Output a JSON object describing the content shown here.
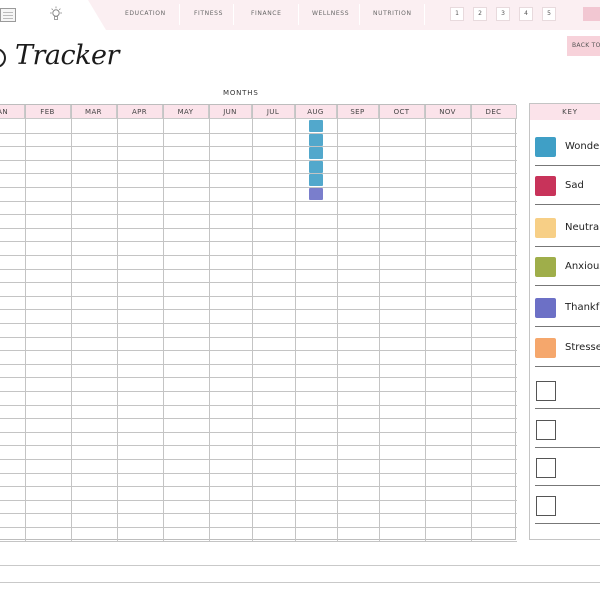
{
  "nav": {
    "icons": [
      "calendar-icon",
      "lightbulb-icon"
    ],
    "items": [
      "EDUCATION",
      "FITNESS",
      "FINANCE",
      "WELLNESS",
      "NUTRITION"
    ],
    "pages": [
      "1",
      "2",
      "3",
      "4",
      "5"
    ]
  },
  "header": {
    "title": "Tracker",
    "back_label": "BACK TO"
  },
  "grid": {
    "heading": "MONTHS",
    "months": [
      "JAN",
      "FEB",
      "MAR",
      "APR",
      "MAY",
      "JUN",
      "JUL",
      "AUG",
      "SEP",
      "OCT",
      "NOV",
      "DEC"
    ],
    "row_count": 31,
    "entries": [
      {
        "month": "AUG",
        "day": 1,
        "mood": "Wonderful"
      },
      {
        "month": "AUG",
        "day": 2,
        "mood": "Wonderful"
      },
      {
        "month": "AUG",
        "day": 3,
        "mood": "Wonderful"
      },
      {
        "month": "AUG",
        "day": 4,
        "mood": "Wonderful"
      },
      {
        "month": "AUG",
        "day": 5,
        "mood": "Wonderful"
      },
      {
        "month": "AUG",
        "day": 6,
        "mood": "Thankful"
      }
    ]
  },
  "key": {
    "heading": "KEY",
    "moods": [
      {
        "label": "Wonderful",
        "color": "#3f9fc6"
      },
      {
        "label": "Sad",
        "color": "#c8335a"
      },
      {
        "label": "Neutral",
        "color": "#f7cf86"
      },
      {
        "label": "Anxious",
        "color": "#9fae4a"
      },
      {
        "label": "Thankful",
        "color": "#6c70c6"
      },
      {
        "label": "Stressed",
        "color": "#f5a76c"
      }
    ],
    "empty_slots": 4
  }
}
